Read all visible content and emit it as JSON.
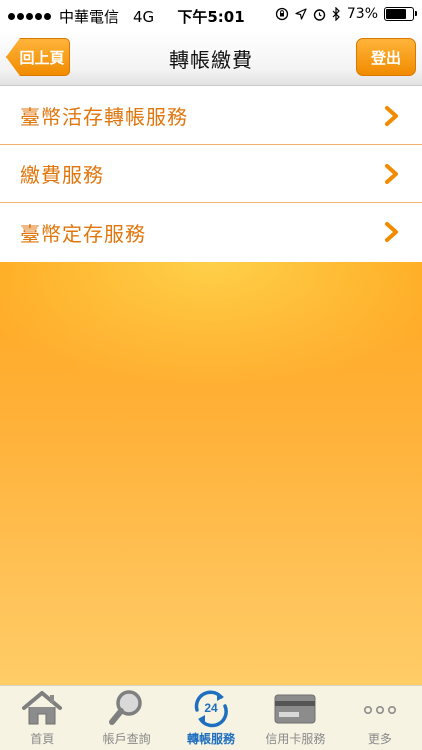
{
  "status_bar": {
    "carrier": "中華電信",
    "network": "4G",
    "time": "下午5:01",
    "battery": "73%",
    "battery_level": 0.73
  },
  "nav": {
    "title": "轉帳繳費",
    "back_label": "回上頁",
    "logout_label": "登出"
  },
  "menu": {
    "items": [
      {
        "label": "臺幣活存轉帳服務"
      },
      {
        "label": "繳費服務"
      },
      {
        "label": "臺幣定存服務"
      }
    ]
  },
  "tab_bar": {
    "tabs": [
      {
        "label": "首頁",
        "icon": "home-icon"
      },
      {
        "label": "帳戶查詢",
        "icon": "magnifier-icon"
      },
      {
        "label": "轉帳服務",
        "icon": "transfer-24-icon",
        "active": true,
        "badge": "24"
      },
      {
        "label": "信用卡服務",
        "icon": "credit-card-icon"
      },
      {
        "label": "更多",
        "icon": "more-icon"
      }
    ]
  },
  "colors": {
    "accent": "#f18b00",
    "menu_text": "#e0760d",
    "active_tab": "#1f6fbf"
  }
}
